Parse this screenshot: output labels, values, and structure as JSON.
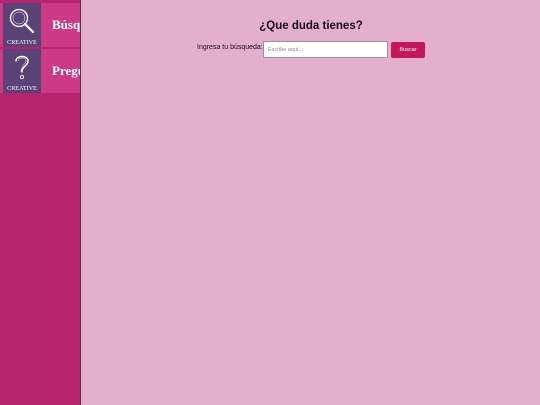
{
  "sidebar": {
    "items": [
      {
        "label": "Búsqueda",
        "icon": "magnifier-icon",
        "logo_caption": "CREATIVE"
      },
      {
        "label": "Preguntas",
        "icon": "question-mark-icon",
        "logo_caption": "CREATIVE"
      }
    ]
  },
  "main": {
    "title": "¿Que duda tienes?",
    "search": {
      "label": "Ingresa tu búsqueda:",
      "placeholder": "Escribe aquí...",
      "value": "",
      "button_label": "Buscar"
    }
  },
  "colors": {
    "sidebar_bg": "#b7246d",
    "sidebar_item_bg": "#cc3a86",
    "logo_bg": "#5c4377",
    "page_bg": "#e3afcd",
    "accent": "#c2185b"
  }
}
